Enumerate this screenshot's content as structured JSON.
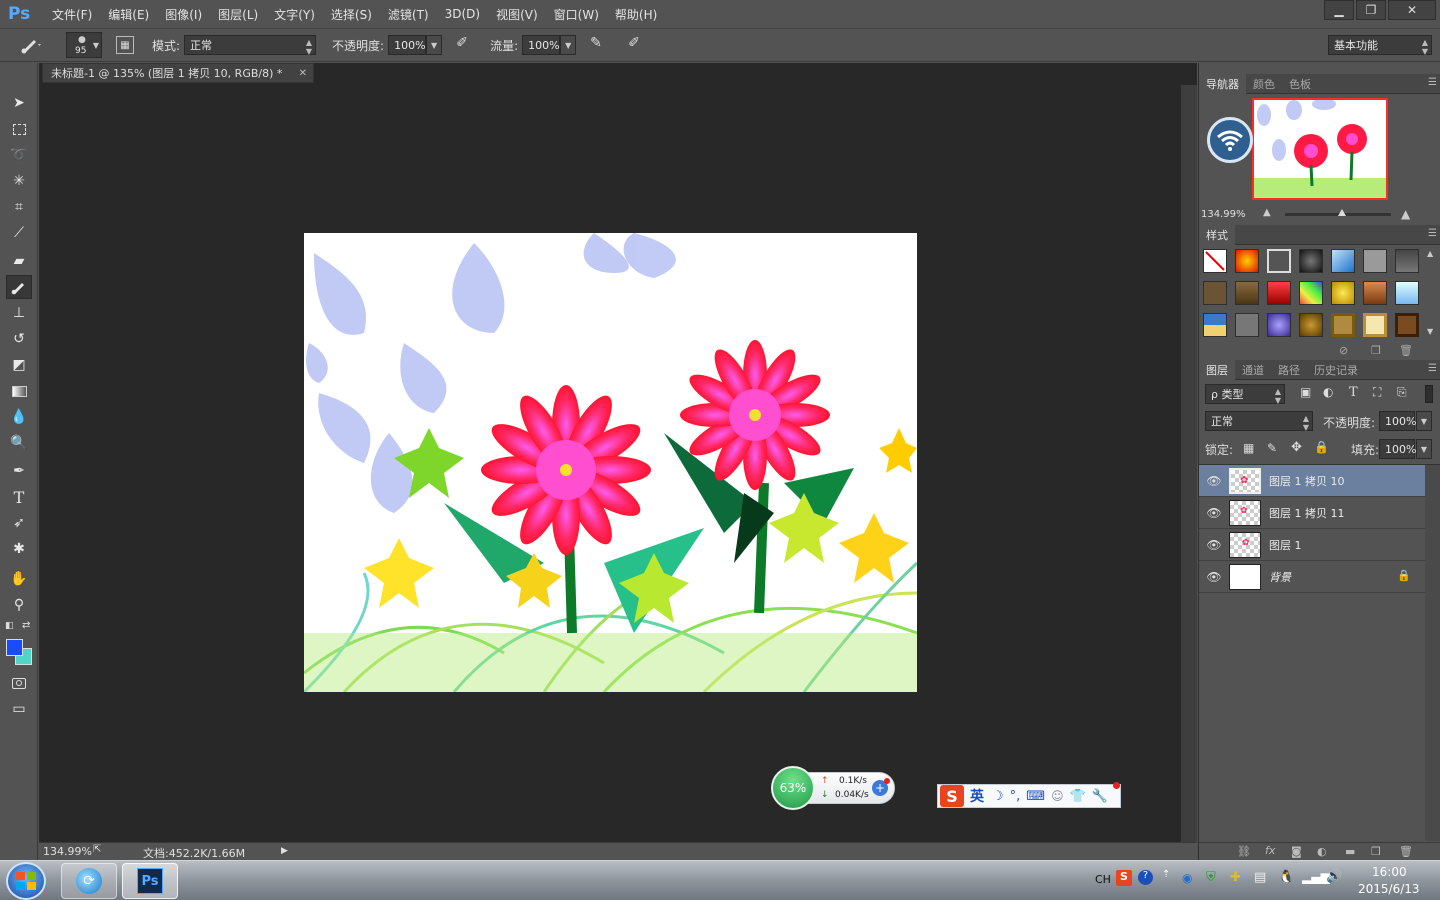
{
  "app": {
    "logo": "Ps",
    "menu": [
      "文件(F)",
      "编辑(E)",
      "图像(I)",
      "图层(L)",
      "文字(Y)",
      "选择(S)",
      "滤镜(T)",
      "3D(D)",
      "视图(V)",
      "窗口(W)",
      "帮助(H)"
    ],
    "window_buttons": [
      "minimize-icon",
      "restore-icon",
      "close-icon"
    ]
  },
  "options": {
    "brush_size": "95",
    "mode_label": "模式:",
    "mode_value": "正常",
    "opacity_label": "不透明度:",
    "opacity_value": "100%",
    "flow_label": "流量:",
    "flow_value": "100%",
    "workspace": "基本功能"
  },
  "document": {
    "tab_title": "未标题-1 @ 135% (图层 1 拷贝 10, RGB/8) *",
    "zoom": "134.99%",
    "doc_info": "文档:452.2K/1.66M"
  },
  "colors": {
    "foreground": "#1a4cff",
    "background": "#4fd6c6",
    "selected_layer": "#6b7f9e",
    "canvas_bg": "#282828"
  },
  "navigator": {
    "tabs": [
      "导航器",
      "颜色",
      "色板"
    ],
    "zoom": "134.99%"
  },
  "styles": {
    "tab": "样式"
  },
  "layers": {
    "tabs": [
      "图层",
      "通道",
      "路径",
      "历史记录"
    ],
    "filter_label": "ρ 类型",
    "blend_mode": "正常",
    "opacity_label": "不透明度:",
    "opacity_value": "100%",
    "lock_label": "锁定:",
    "fill_label": "填充:",
    "fill_value": "100%",
    "items": [
      {
        "name": "图层 1 拷贝 10",
        "selected": true
      },
      {
        "name": "图层 1 拷贝 11",
        "selected": false
      },
      {
        "name": "图层 1",
        "selected": false
      },
      {
        "name": "背景",
        "selected": false,
        "locked": true
      }
    ]
  },
  "net_widget": {
    "percent": "63%",
    "up": "0.1K/s",
    "down": "0.04K/s"
  },
  "ime": {
    "lang": "英"
  },
  "taskbar": {
    "lang": "CH",
    "time": "16:00",
    "date": "2015/6/13"
  }
}
